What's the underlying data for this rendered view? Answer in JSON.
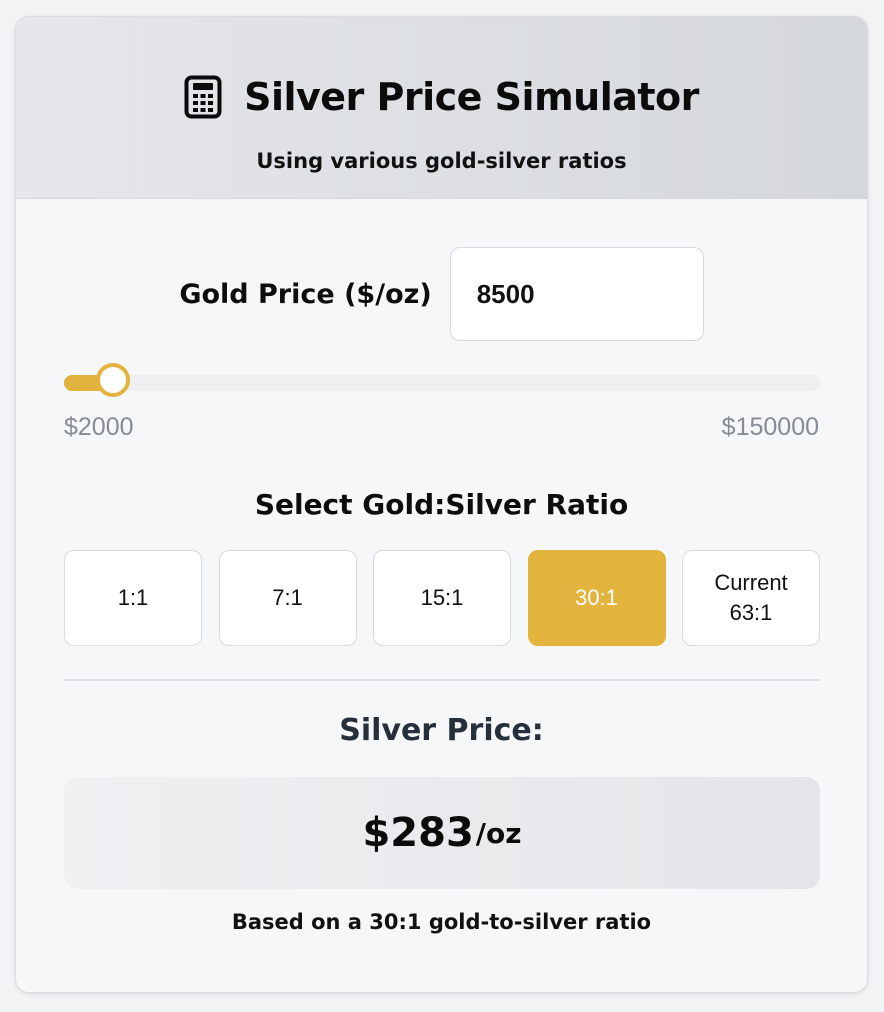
{
  "header": {
    "icon": "calculator-icon",
    "title": "Silver Price Simulator",
    "subtitle": "Using various gold-silver ratios"
  },
  "gold_price": {
    "label": "Gold Price ($/oz)",
    "value": "8500"
  },
  "slider": {
    "min_label": "$2000",
    "max_label": "$150000",
    "min": 2000,
    "max": 150000,
    "value": 8500
  },
  "ratio": {
    "heading": "Select Gold:Silver Ratio",
    "options": [
      {
        "label": "1:1",
        "active": false
      },
      {
        "label": "7:1",
        "active": false
      },
      {
        "label": "15:1",
        "active": false
      },
      {
        "label": "30:1",
        "active": true
      },
      {
        "label": "Current\n63:1",
        "active": false
      }
    ]
  },
  "result": {
    "heading": "Silver Price:",
    "price": "$283",
    "unit": "/oz",
    "basis": "Based on a 30:1 gold-to-silver ratio"
  },
  "colors": {
    "accent": "#e2b43e",
    "muted_text": "#858c96"
  }
}
